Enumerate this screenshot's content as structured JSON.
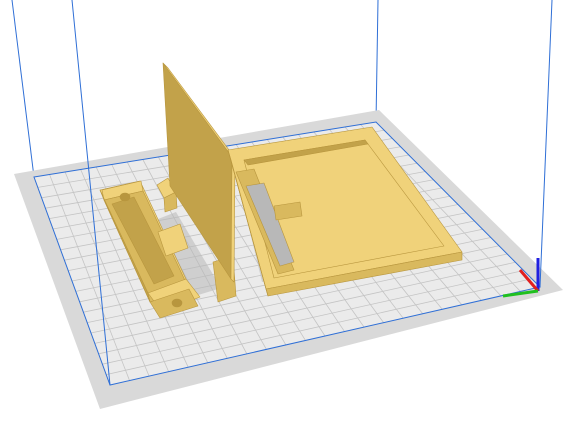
{
  "app": {
    "view": "3d-build-plate-viewport"
  },
  "colors": {
    "background": "#ffffff",
    "plate_outer": "#d9d9d9",
    "plate_inner": "#ebebeb",
    "grid_line": "#c4c4c4",
    "build_volume_line": "#2f6fd6",
    "model_top": "#f0d27a",
    "model_side": "#d9b95e",
    "model_dark": "#c2a24a",
    "model_edge": "#b8963e",
    "shadow": "#b8b8b8",
    "axis_x": "#e02020",
    "axis_y": "#20c020",
    "axis_z": "#2020e0"
  },
  "scene": {
    "objects": [
      {
        "name": "long-narrow-bracket",
        "icon": "model-object"
      },
      {
        "name": "vertical-panel",
        "icon": "model-object"
      },
      {
        "name": "small-side-bracket",
        "icon": "model-object"
      },
      {
        "name": "tray-frame",
        "icon": "model-object"
      }
    ],
    "axis_gizmo": {
      "icon": "xyz-axes-icon"
    }
  }
}
